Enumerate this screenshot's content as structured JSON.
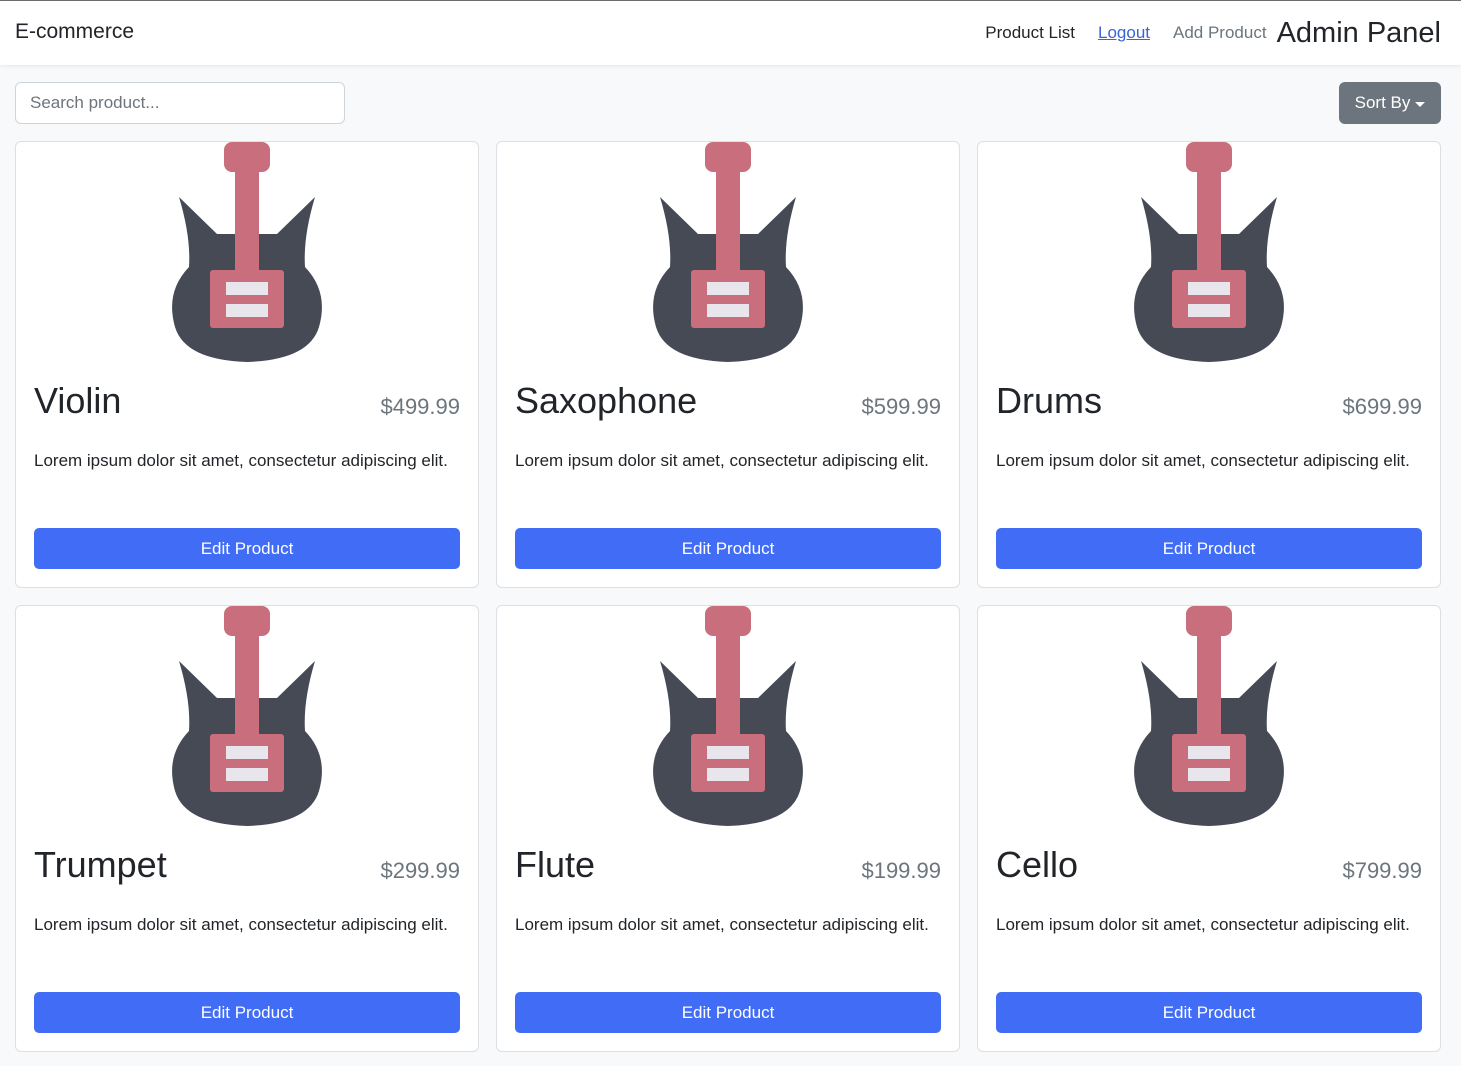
{
  "navbar": {
    "brand": "E-commerce",
    "links": {
      "product_list": "Product List",
      "logout": "Logout",
      "add_product": "Add Product"
    },
    "panel_title": "Admin Panel"
  },
  "toolbar": {
    "search_placeholder": "Search product...",
    "sort_label": "Sort By"
  },
  "colors": {
    "primary": "#416cf6",
    "secondary": "#6c757d",
    "guitar_body": "#454a55",
    "guitar_neck": "#c86e7d",
    "guitar_pickup": "#e8e6ec"
  },
  "products": [
    {
      "name": "Violin",
      "price": "$499.99",
      "description": "Lorem ipsum dolor sit amet, consectetur adipiscing elit.",
      "image_icon": "guitar-icon",
      "button_label": "Edit Product"
    },
    {
      "name": "Saxophone",
      "price": "$599.99",
      "description": "Lorem ipsum dolor sit amet, consectetur adipiscing elit.",
      "image_icon": "guitar-icon",
      "button_label": "Edit Product"
    },
    {
      "name": "Drums",
      "price": "$699.99",
      "description": "Lorem ipsum dolor sit amet, consectetur adipiscing elit.",
      "image_icon": "guitar-icon",
      "button_label": "Edit Product"
    },
    {
      "name": "Trumpet",
      "price": "$299.99",
      "description": "Lorem ipsum dolor sit amet, consectetur adipiscing elit.",
      "image_icon": "guitar-icon",
      "button_label": "Edit Product"
    },
    {
      "name": "Flute",
      "price": "$199.99",
      "description": "Lorem ipsum dolor sit amet, consectetur adipiscing elit.",
      "image_icon": "guitar-icon",
      "button_label": "Edit Product"
    },
    {
      "name": "Cello",
      "price": "$799.99",
      "description": "Lorem ipsum dolor sit amet, consectetur adipiscing elit.",
      "image_icon": "guitar-icon",
      "button_label": "Edit Product"
    }
  ]
}
